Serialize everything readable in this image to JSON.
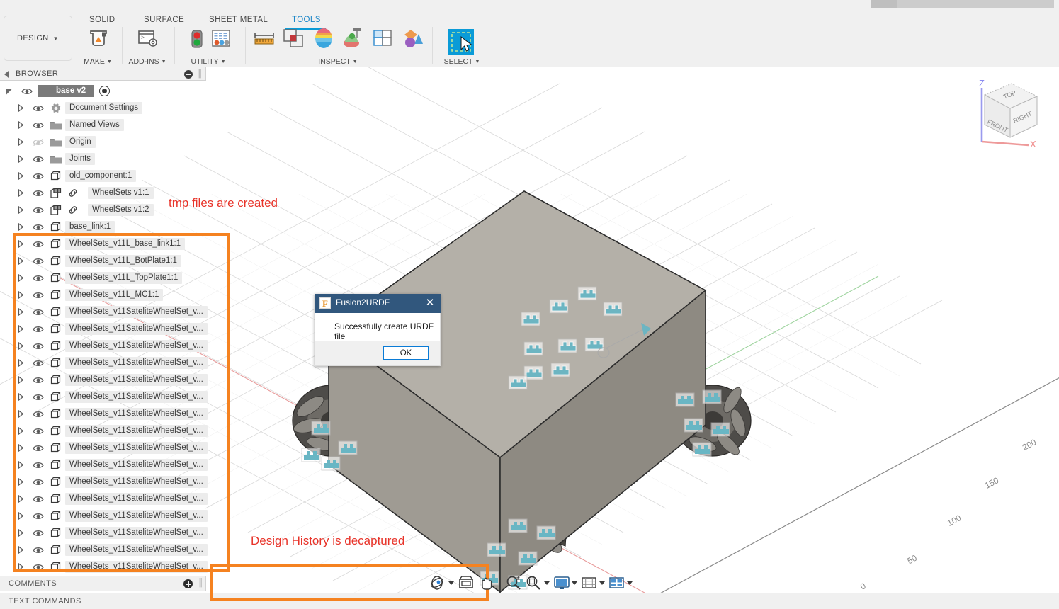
{
  "app": {
    "workspace_button": "DESIGN",
    "tabs": [
      {
        "label": "SOLID",
        "active": false
      },
      {
        "label": "SURFACE",
        "active": false
      },
      {
        "label": "SHEET METAL",
        "active": false
      },
      {
        "label": "TOOLS",
        "active": true
      }
    ],
    "panels": [
      {
        "label": "MAKE",
        "icon": "3d-print-icon",
        "has_caret": true
      },
      {
        "label": "ADD-INS",
        "icon": "scripts-and-addins-icon",
        "has_caret": true
      },
      {
        "label": "UTILITY",
        "icons": [
          "traffic-light-icon",
          "spreadsheet-icon"
        ],
        "has_caret": true
      },
      {
        "label": "INSPECT",
        "icons": [
          "measure-ruler-icon",
          "interference-icon",
          "curvature-comb-icon",
          "section-analysis-icon",
          "zebra-icon",
          "component-color-cycle-icon"
        ],
        "has_caret": true
      },
      {
        "label": "SELECT",
        "icon": "select-window-icon",
        "has_caret": true
      }
    ]
  },
  "browser": {
    "title": "BROWSER",
    "root": {
      "label": "base v2",
      "icon": "component-icon"
    },
    "items": [
      {
        "label": "Document Settings",
        "icon": "gear-icon",
        "indent": 0,
        "eye": false
      },
      {
        "label": "Named Views",
        "icon": "folder-icon",
        "indent": 0,
        "eye": true
      },
      {
        "label": "Origin",
        "icon": "folder-icon",
        "indent": 1,
        "eye": true,
        "hidden": true
      },
      {
        "label": "Joints",
        "icon": "folder-icon",
        "indent": 1,
        "eye": true
      },
      {
        "label": "old_component:1",
        "icon": "body-icon",
        "indent": 1,
        "eye": true
      },
      {
        "label": "WheelSets v1:1",
        "icon": "component-icon",
        "indent": 2,
        "eye": true,
        "link": true
      },
      {
        "label": "WheelSets v1:2",
        "icon": "component-icon",
        "indent": 2,
        "eye": true,
        "link": true
      },
      {
        "label": "base_link:1",
        "icon": "body-icon",
        "indent": 1,
        "eye": true
      },
      {
        "label": "WheelSets_v11L_base_link1:1",
        "icon": "body-icon",
        "indent": 1,
        "eye": true
      },
      {
        "label": "WheelSets_v11L_BotPlate1:1",
        "icon": "body-icon",
        "indent": 1,
        "eye": true
      },
      {
        "label": "WheelSets_v11L_TopPlate1:1",
        "icon": "body-icon",
        "indent": 1,
        "eye": true
      },
      {
        "label": "WheelSets_v11L_MC1:1",
        "icon": "body-icon",
        "indent": 1,
        "eye": true
      },
      {
        "label": "WheelSets_v11SateliteWheelSet_v...",
        "icon": "body-icon",
        "indent": 1,
        "eye": true
      },
      {
        "label": "WheelSets_v11SateliteWheelSet_v...",
        "icon": "body-icon",
        "indent": 1,
        "eye": true
      },
      {
        "label": "WheelSets_v11SateliteWheelSet_v...",
        "icon": "body-icon",
        "indent": 1,
        "eye": true
      },
      {
        "label": "WheelSets_v11SateliteWheelSet_v...",
        "icon": "body-icon",
        "indent": 1,
        "eye": true
      },
      {
        "label": "WheelSets_v11SateliteWheelSet_v...",
        "icon": "body-icon",
        "indent": 1,
        "eye": true
      },
      {
        "label": "WheelSets_v11SateliteWheelSet_v...",
        "icon": "body-icon",
        "indent": 1,
        "eye": true
      },
      {
        "label": "WheelSets_v11SateliteWheelSet_v...",
        "icon": "body-icon",
        "indent": 1,
        "eye": true
      },
      {
        "label": "WheelSets_v11SateliteWheelSet_v...",
        "icon": "body-icon",
        "indent": 1,
        "eye": true
      },
      {
        "label": "WheelSets_v11SateliteWheelSet_v...",
        "icon": "body-icon",
        "indent": 1,
        "eye": true
      },
      {
        "label": "WheelSets_v11SateliteWheelSet_v...",
        "icon": "body-icon",
        "indent": 1,
        "eye": true
      },
      {
        "label": "WheelSets_v11SateliteWheelSet_v...",
        "icon": "body-icon",
        "indent": 1,
        "eye": true
      },
      {
        "label": "WheelSets_v11SateliteWheelSet_v...",
        "icon": "body-icon",
        "indent": 1,
        "eye": true
      },
      {
        "label": "WheelSets_v11SateliteWheelSet_v...",
        "icon": "body-icon",
        "indent": 1,
        "eye": true
      },
      {
        "label": "WheelSets_v11SateliteWheelSet_v...",
        "icon": "body-icon",
        "indent": 1,
        "eye": true
      },
      {
        "label": "WheelSets_v11SateliteWheelSet_v...",
        "icon": "body-icon",
        "indent": 1,
        "eye": true
      },
      {
        "label": "WheelSets_v11SateliteWheelSet_v...",
        "icon": "body-icon",
        "indent": 1,
        "eye": true
      }
    ]
  },
  "dialog": {
    "title": "Fusion2URDF",
    "message": "Successfully create URDF file",
    "ok_label": "OK",
    "close_glyph": "✕",
    "titlebar_color": "#31577d",
    "ok_border_color": "#0a7bd6"
  },
  "annotations": [
    {
      "text": "tmp files are created",
      "color": "#e8342a"
    },
    {
      "text": "Design History is decaptured",
      "color": "#e8342a"
    }
  ],
  "highlight": {
    "color": "#f58220"
  },
  "viewcube": {
    "faces": [
      "TOP",
      "FRONT",
      "RIGHT"
    ],
    "axes": [
      {
        "label": "Z",
        "color": "#8c8cf0"
      },
      {
        "label": "X",
        "color": "#f08c8c"
      }
    ]
  },
  "grid_ruler": {
    "ticks": [
      "0",
      "50",
      "100",
      "150",
      "200"
    ]
  },
  "navbar": {
    "items": [
      {
        "name": "orbit-icon",
        "has_caret": true
      },
      {
        "name": "look-at-icon",
        "has_caret": false
      },
      {
        "name": "pan-hand-icon",
        "has_caret": false
      },
      {
        "name": "zoom-icon",
        "has_caret": false
      },
      {
        "name": "zoom-window-icon",
        "has_caret": true
      },
      {
        "name": "display-settings-icon",
        "has_caret": true
      },
      {
        "name": "grid-snaps-icon",
        "has_caret": true
      },
      {
        "name": "viewports-icon",
        "has_caret": true
      }
    ]
  },
  "footer": {
    "comments_label": "COMMENTS",
    "text_commands_label": "TEXT COMMANDS"
  }
}
